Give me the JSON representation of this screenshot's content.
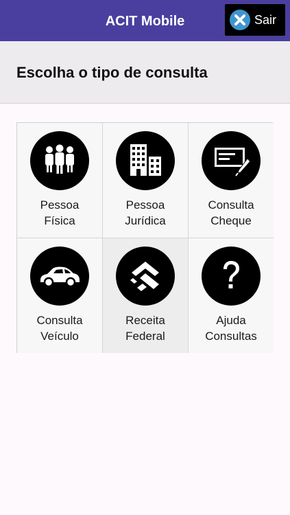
{
  "app": {
    "title": "ACIT Mobile",
    "logout_label": "Sair"
  },
  "header": {
    "title": "Escolha o tipo de consulta"
  },
  "menu": [
    {
      "line1": "Pessoa",
      "line2": "Física",
      "icon": "people-icon"
    },
    {
      "line1": "Pessoa",
      "line2": "Jurídica",
      "icon": "buildings-icon"
    },
    {
      "line1": "Consulta",
      "line2": "Cheque",
      "icon": "cheque-icon"
    },
    {
      "line1": "Consulta",
      "line2": "Veículo",
      "icon": "car-icon"
    },
    {
      "line1": "Receita",
      "line2": "Federal",
      "icon": "receita-federal-icon"
    },
    {
      "line1": "Ajuda",
      "line2": "Consultas",
      "icon": "question-icon"
    }
  ],
  "colors": {
    "topbar": "#4a3f9e",
    "logout_icon": "#3f95d0"
  }
}
